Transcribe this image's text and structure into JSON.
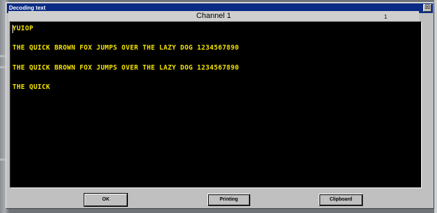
{
  "window": {
    "title": "Decoding text",
    "close_symbol": "☒"
  },
  "channel": {
    "label": "Channel 1",
    "number": "1"
  },
  "decoded_lines": [
    "YUIOP",
    "THE QUICK BROWN FOX JUMPS OVER THE LAZY DOG 1234567890",
    "THE QUICK BROWN FOX JUMPS OVER THE LAZY DOG 1234567890",
    "THE QUICK"
  ],
  "buttons": {
    "ok": "OK",
    "printing": "Printing",
    "clipboard": "Clipboard"
  },
  "colors": {
    "titlebar": "#0a2a86",
    "text_background": "#000000",
    "decoded_text": "#f2e200"
  }
}
